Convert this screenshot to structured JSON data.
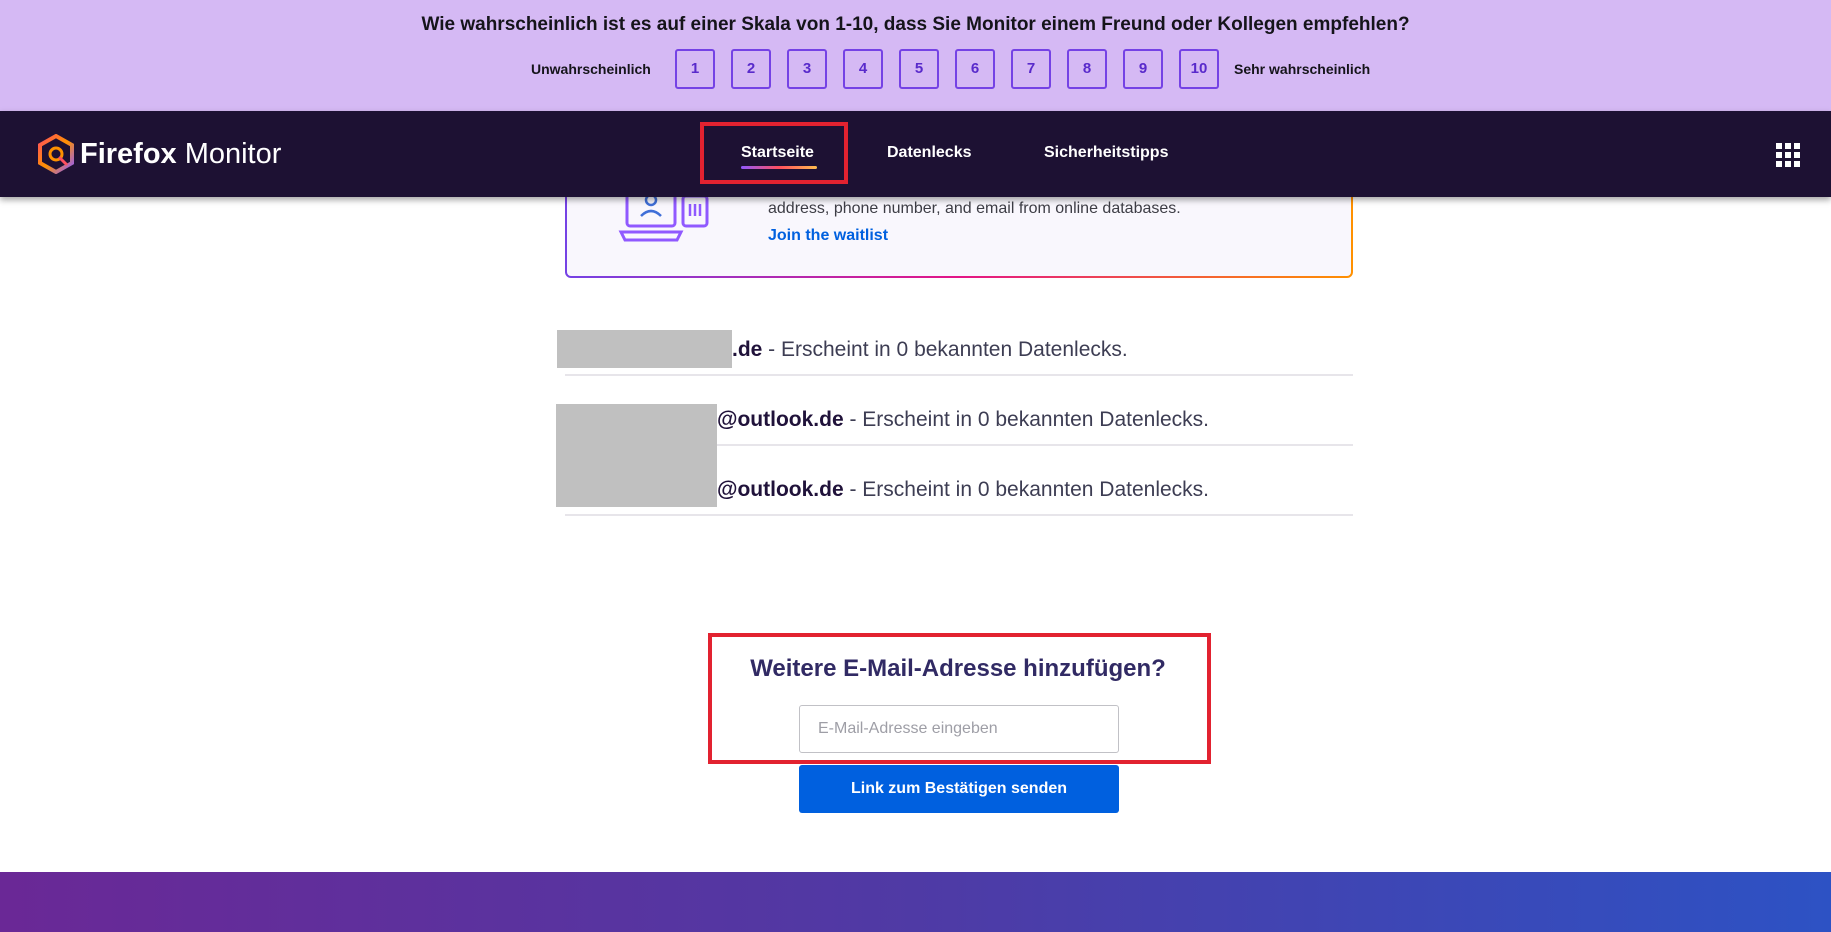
{
  "survey": {
    "question": "Wie wahrscheinlich ist es auf einer Skala von 1-10, dass Sie Monitor einem Freund oder Kollegen empfehlen?",
    "low_label": "Unwahrscheinlich",
    "high_label": "Sehr wahrscheinlich",
    "scores": [
      "1",
      "2",
      "3",
      "4",
      "5",
      "6",
      "7",
      "8",
      "9",
      "10"
    ]
  },
  "header": {
    "logo_firefox": "Firefox",
    "logo_monitor": "Monitor",
    "nav": {
      "home": "Startseite",
      "breaches": "Datenlecks",
      "tips": "Sicherheitstipps"
    },
    "apps_icon": "grid-icon"
  },
  "promo": {
    "text": "address, phone number, and email from online databases.",
    "link": "Join the waitlist"
  },
  "emails": [
    {
      "domain": ".de",
      "status": " - Erscheint in 0 bekannten Datenlecks."
    },
    {
      "domain": "@outlook.de",
      "status": " - Erscheint in 0 bekannten Datenlecks."
    },
    {
      "domain": "@outlook.de",
      "status": " - Erscheint in 0 bekannten Datenlecks."
    }
  ],
  "add_email": {
    "title": "Weitere E-Mail-Adresse hinzufügen?",
    "placeholder": "E-Mail-Adresse eingeben",
    "button": "Link zum Bestätigen senden"
  },
  "colors": {
    "survey_bg": "#d5b9f4",
    "header_bg": "#1d1133",
    "primary_button": "#0060df",
    "highlight": "#e22230"
  }
}
